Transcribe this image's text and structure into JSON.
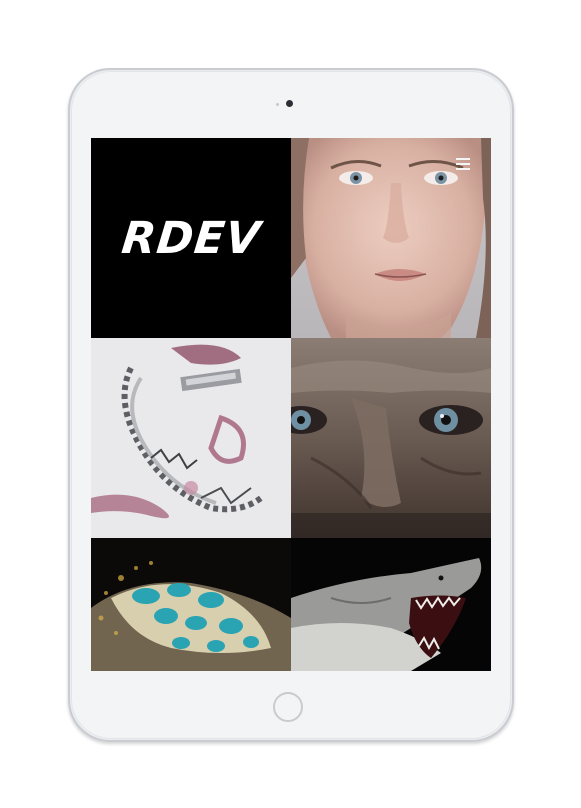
{
  "brand": {
    "logo_text": "RDEV"
  },
  "header": {
    "menu_icon": "hamburger-menu-icon"
  },
  "gallery": {
    "items": [
      {
        "name": "logo-tile"
      },
      {
        "name": "woman-portrait"
      },
      {
        "name": "abstract-sculpture"
      },
      {
        "name": "eyes-closeup"
      },
      {
        "name": "coral-creature"
      },
      {
        "name": "shark"
      }
    ]
  },
  "colors": {
    "screen_bg": "#000000",
    "device_body": "#f3f4f6",
    "logo": "#ffffff"
  }
}
